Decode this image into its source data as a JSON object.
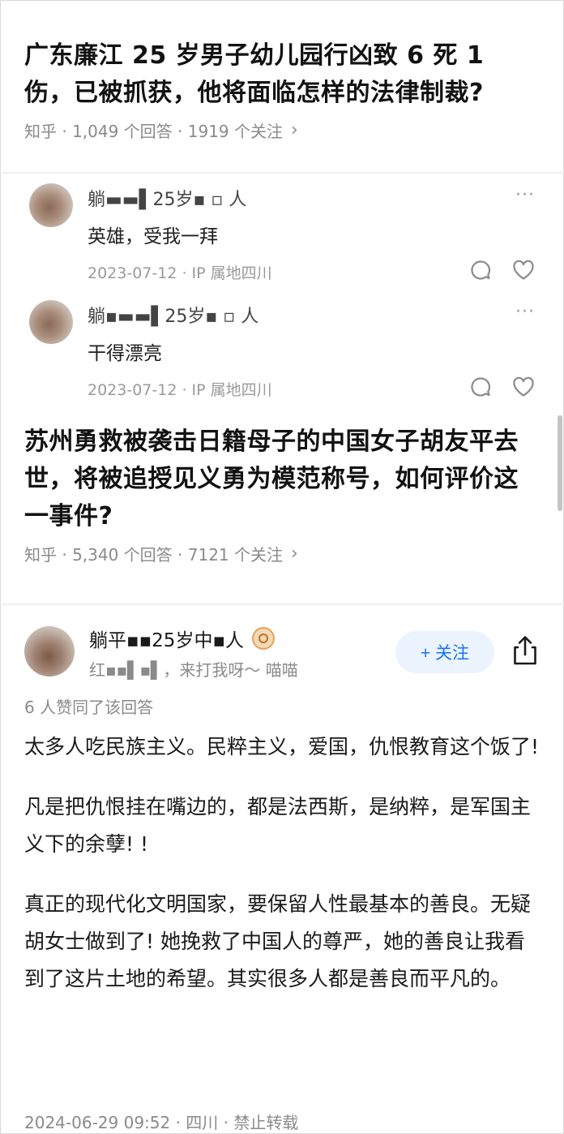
{
  "question1": {
    "title": "广东廉江 25 岁男子幼儿园行凶致 6 死 1 伤，已被抓获，他将面临怎样的法律制裁?",
    "meta": "知乎 · 1,049 个回答 · 1919 个关注",
    "chevron": "›"
  },
  "comments": [
    {
      "author": "躺▬▬▌25岁▪ ▫ 人",
      "text": "英雄，受我一拜",
      "date": "2023-07-12 · IP 属地四川",
      "more": "···"
    },
    {
      "author": "躺▪▬▬▌25岁▪ ▫ 人",
      "text": "干得漂亮",
      "date": "2023-07-12 · IP 属地四川",
      "more": "···"
    }
  ],
  "question2": {
    "title": "苏州勇救被袭击日籍母子的中国女子胡友平去世，将被追授见义勇为模范称号，如何评价这一事件?",
    "meta": "知乎 · 5,340 个回答 · 7121 个关注",
    "chevron": "›"
  },
  "answer": {
    "author": "躺平▪▪25岁中▪人",
    "bio": "红▪▪▌▪▌，来打我呀～ 喵喵",
    "follow_label": "+ 关注",
    "upvotes": "6 人赞同了该回答",
    "paragraphs": [
      "太多人吃民族主义。民粹主义，爱国，仇恨教育这个饭了!",
      "凡是把仇恨挂在嘴边的，都是法西斯，是纳粹，是军国主义下的余孽! !",
      "真正的现代化文明国家，要保留人性最基本的善良。无疑胡女士做到了! 她挽救了中国人的尊严，她的善良让我看到了这片土地的希望。其实很多人都是善良而平凡的。"
    ],
    "footer": "2024-06-29 09:52 · 四川 · 禁止转载"
  },
  "colors": {
    "accent": "#1772f6",
    "follow_bg": "#ebf3ff",
    "meta_gray": "#8a8a8a"
  },
  "icons": {
    "reply": "reply-bubble-icon",
    "like": "heart-icon",
    "more": "more-dots-icon",
    "share": "share-icon",
    "badge": "creator-badge-icon"
  }
}
